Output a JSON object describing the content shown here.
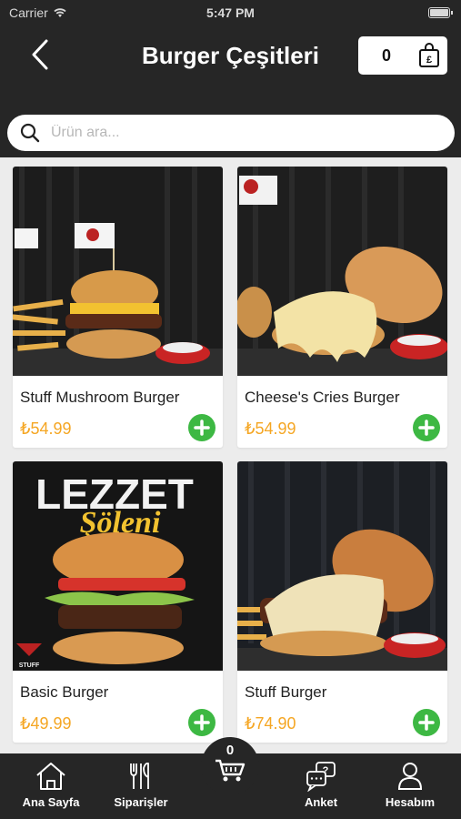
{
  "status_bar": {
    "carrier": "Carrier",
    "time": "5:47 PM"
  },
  "header": {
    "title": "Burger Çeşitleri",
    "cart_count": "0"
  },
  "search": {
    "placeholder": "Ürün ara..."
  },
  "products": [
    {
      "name": "Stuff Mushroom Burger",
      "price": "₺54.99"
    },
    {
      "name": "Cheese's Cries Burger",
      "price": "₺54.99"
    },
    {
      "name": "Basic Burger",
      "price": "₺49.99"
    },
    {
      "name": "Stuff Burger",
      "price": "₺74.90"
    }
  ],
  "promo": {
    "line1": "LEZZET",
    "line2": "Şöleni",
    "badge": "STUFF"
  },
  "tab_bar": {
    "home": "Ana Sayfa",
    "orders": "Siparişler",
    "cart_count": "0",
    "survey": "Anket",
    "account": "Hesabım"
  },
  "colors": {
    "dark": "#262626",
    "price": "#f5a623",
    "add": "#3db843"
  },
  "icons": [
    "back-chevron-icon",
    "shopping-bag-icon",
    "search-icon",
    "plus-icon",
    "home-icon",
    "fork-knife-icon",
    "cart-icon",
    "chat-question-icon",
    "user-icon"
  ]
}
